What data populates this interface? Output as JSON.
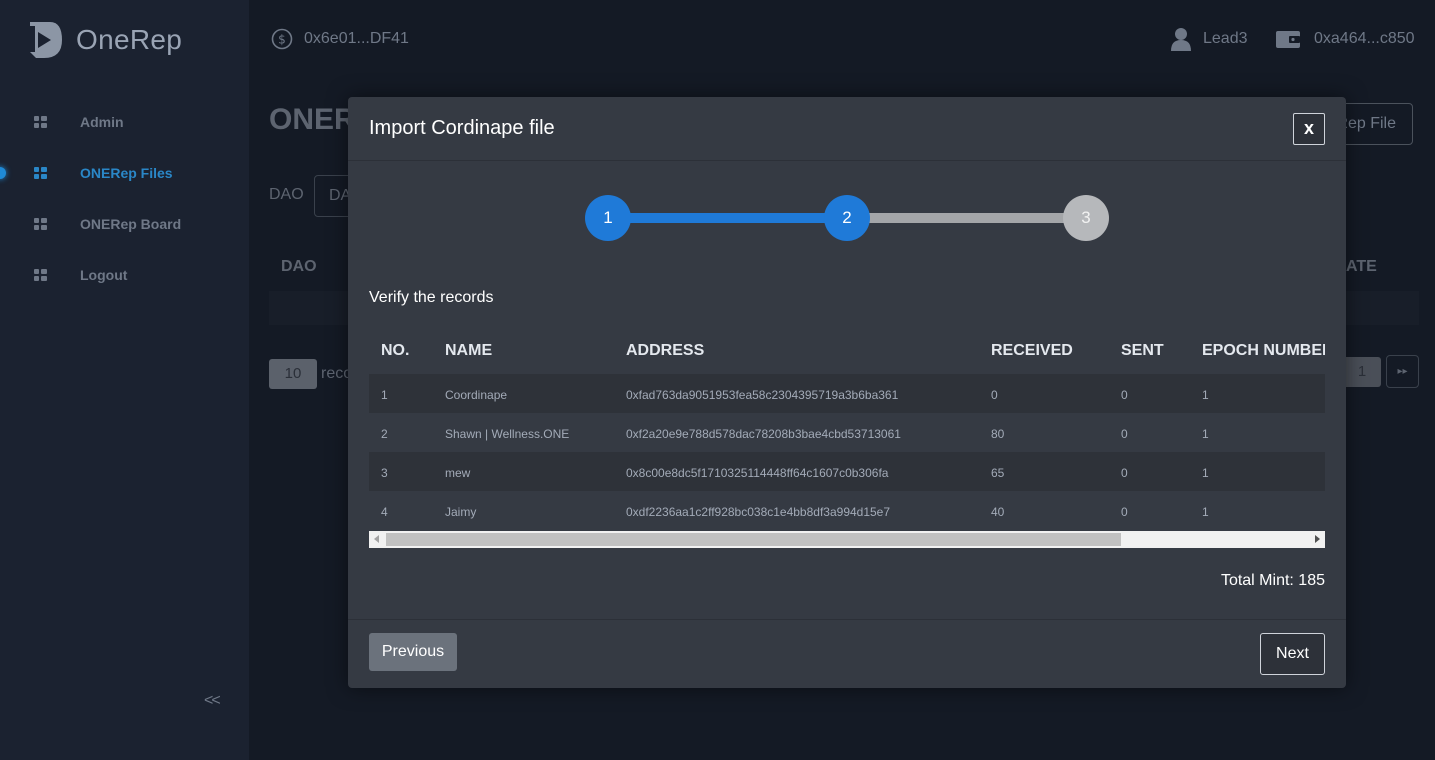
{
  "app": {
    "name": "OneRep"
  },
  "sidebar": {
    "items": [
      {
        "label": "Admin"
      },
      {
        "label": "ONERep Files",
        "active": true
      },
      {
        "label": "ONERep Board"
      },
      {
        "label": "Logout"
      }
    ],
    "collapse_label": "<<"
  },
  "header": {
    "contract_address": "0x6e01...DF41",
    "user_name": "Lead3",
    "wallet_address": "0xa464...c850"
  },
  "background_page": {
    "title": "ONER",
    "upload_button": "Rep File",
    "dao_label": "DAO",
    "dao_select_value": "DA",
    "columns": {
      "first": "DAO",
      "last": "ATE"
    },
    "page_size": "10",
    "records_label": "reco",
    "current_page": "1",
    "next_page_icon": "▸▸"
  },
  "modal": {
    "title": "Import Cordinape file",
    "close_label": "x",
    "steps": [
      "1",
      "2",
      "3"
    ],
    "current_step": 2,
    "instruction": "Verify the records",
    "table": {
      "headers": [
        "NO.",
        "NAME",
        "ADDRESS",
        "RECEIVED",
        "SENT",
        "EPOCH NUMBEI"
      ],
      "rows": [
        [
          "1",
          "Coordinape",
          "0xfad763da9051953fea58c2304395719a3b6ba361",
          "0",
          "0",
          "1"
        ],
        [
          "2",
          "Shawn | Wellness.ONE",
          "0xf2a20e9e788d578dac78208b3bae4cbd53713061",
          "80",
          "0",
          "1"
        ],
        [
          "3",
          "mew",
          "0x8c00e8dc5f1710325114448ff64c1607c0b306fa",
          "65",
          "0",
          "1"
        ],
        [
          "4",
          "Jaimy",
          "0xdf2236aa1c2ff928bc038c1e4bb8df3a994d15e7",
          "40",
          "0",
          "1"
        ]
      ]
    },
    "total_mint": "Total Mint: 185",
    "previous_label": "Previous",
    "next_label": "Next"
  },
  "colors": {
    "accent": "#1f7ad8",
    "sidebar_active": "#2a87c7",
    "modal_bg": "#353a43",
    "page_bg": "#141a25"
  }
}
